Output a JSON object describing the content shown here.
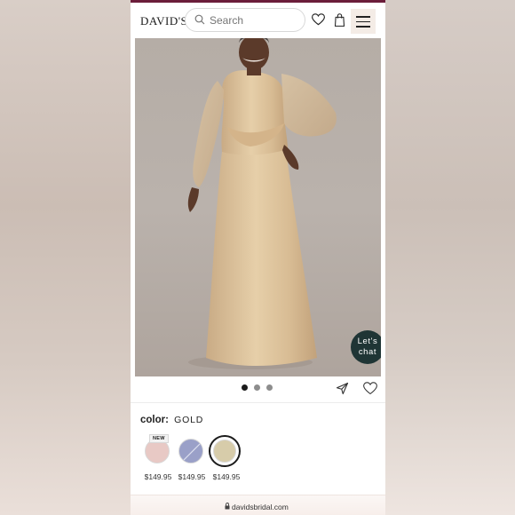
{
  "header": {
    "logo": "DAVID'S",
    "search_placeholder": "Search"
  },
  "product": {
    "chat_label_1": "Let's",
    "chat_label_2": "chat",
    "carousel": {
      "total": 3,
      "active": 1
    },
    "color_label": "color:",
    "color_value": "GOLD",
    "swatches": [
      {
        "name": "blush",
        "color": "#e8c9c5",
        "badge": "NEW",
        "price": "$149.95"
      },
      {
        "name": "periwinkle",
        "color": "#9aa0c8",
        "badge": "",
        "price": "$149.95"
      },
      {
        "name": "gold",
        "color": "#d7ccaa",
        "badge": "",
        "price": "$149.95",
        "selected": true
      }
    ]
  },
  "browser": {
    "url": "davidsbridal.com"
  },
  "colors": {
    "brand_strip": "#6b1d3a",
    "chat_button": "#1f3535",
    "dot_active": "#1b1b1b",
    "dot_inactive": "#8d8d8d"
  }
}
